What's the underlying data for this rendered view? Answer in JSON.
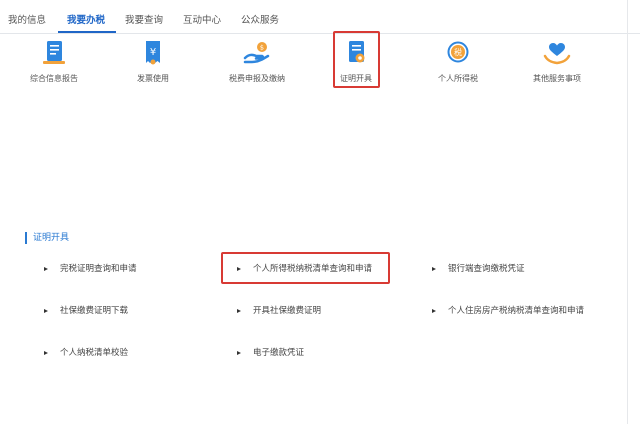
{
  "tabs": [
    {
      "label": "我的信息"
    },
    {
      "label": "我要办税"
    },
    {
      "label": "我要查询"
    },
    {
      "label": "互动中心"
    },
    {
      "label": "公众服务"
    }
  ],
  "services": [
    {
      "label": "综合信息报告",
      "icon": "report-icon"
    },
    {
      "label": "发票使用",
      "icon": "invoice-icon"
    },
    {
      "label": "税费申报及缴纳",
      "icon": "tax-payment-icon"
    },
    {
      "label": "证明开具",
      "icon": "certificate-icon"
    },
    {
      "label": "个人所得税",
      "icon": "income-tax-icon"
    },
    {
      "label": "其他服务事项",
      "icon": "other-services-icon"
    }
  ],
  "section": {
    "title": "证明开具"
  },
  "links": [
    {
      "label": "完税证明查询和申请"
    },
    {
      "label": "个人所得税纳税清单查询和申请"
    },
    {
      "label": "银行端查询缴税凭证"
    },
    {
      "label": "社保缴费证明下载"
    },
    {
      "label": "开具社保缴费证明"
    },
    {
      "label": "个人住房房产税纳税清单查询和申请"
    },
    {
      "label": "个人纳税清单校验"
    },
    {
      "label": "电子缴款凭证"
    }
  ],
  "colors": {
    "accent": "#1f66c7",
    "highlight": "#d83a34",
    "icon_blue": "#2e86de",
    "icon_orange": "#f2a23a"
  }
}
